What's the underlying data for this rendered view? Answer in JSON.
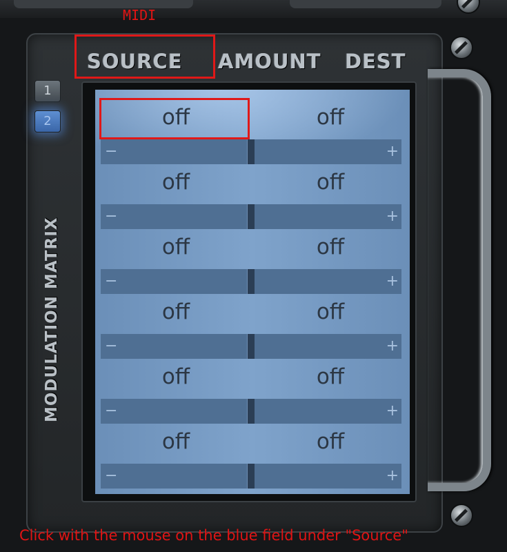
{
  "annotation": {
    "label": "MIDI",
    "instruction": "Click with the mouse on the blue field under \"Source\"",
    "color": "#e01414"
  },
  "panel": {
    "title": "MODULATION MATRIX",
    "pages": [
      "1",
      "2"
    ],
    "active_page": "2"
  },
  "headers": {
    "source": "SOURCE",
    "amount": "AMOUNT",
    "dest": "DEST"
  },
  "rows": [
    {
      "source": "off",
      "dest": "off",
      "minus": "−",
      "plus": "+"
    },
    {
      "source": "off",
      "dest": "off",
      "minus": "−",
      "plus": "+"
    },
    {
      "source": "off",
      "dest": "off",
      "minus": "−",
      "plus": "+"
    },
    {
      "source": "off",
      "dest": "off",
      "minus": "−",
      "plus": "+"
    },
    {
      "source": "off",
      "dest": "off",
      "minus": "−",
      "plus": "+"
    },
    {
      "source": "off",
      "dest": "off",
      "minus": "−",
      "plus": "+"
    }
  ],
  "icons": [
    "screw-icon",
    "handle-icon"
  ]
}
